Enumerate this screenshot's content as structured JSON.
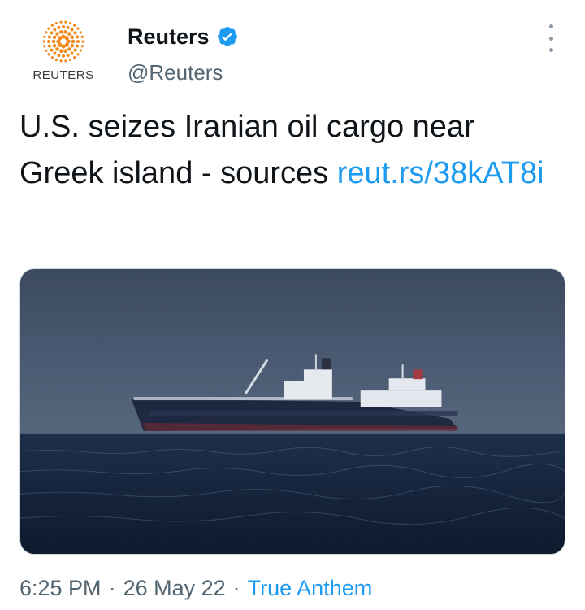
{
  "account": {
    "display_name": "Reuters",
    "handle": "@Reuters",
    "avatar_brand": "REUTERS",
    "verified": true
  },
  "tweet": {
    "text": "U.S. seizes Iranian oil cargo near Greek island - sources ",
    "link": "reut.rs/38kAT8i",
    "image_icon": "oil-tanker-at-sea-photo"
  },
  "meta": {
    "time": "6:25 PM",
    "separator": "·",
    "date": "26 May 22",
    "source": "True Anthem"
  },
  "colors": {
    "link": "#1d9bf0",
    "secondary_text": "#536471",
    "brand_orange": "#f08a1c"
  }
}
